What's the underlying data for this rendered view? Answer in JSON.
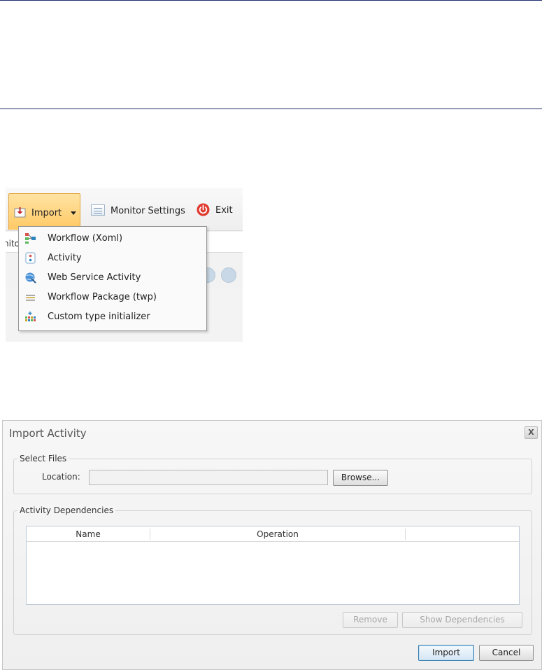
{
  "toolbar": {
    "import_label": "Import",
    "monitor_settings_label": "Monitor Settings",
    "exit_label": "Exit",
    "underlying_tab_text": "nito"
  },
  "import_menu": {
    "items": [
      {
        "label": "Workflow (Xoml)",
        "icon": "workflow-icon"
      },
      {
        "label": "Activity",
        "icon": "activity-icon"
      },
      {
        "label": "Web Service Activity",
        "icon": "web-service-icon"
      },
      {
        "label": "Workflow Package (twp)",
        "icon": "workflow-package-icon"
      },
      {
        "label": "Custom type initializer",
        "icon": "custom-type-icon"
      }
    ]
  },
  "dialog": {
    "title": "Import Activity",
    "close_label": "X",
    "select_files": {
      "legend": "Select Files",
      "location_label": "Location:",
      "location_value": "",
      "browse_label": "Browse..."
    },
    "dependencies": {
      "legend": "Activity Dependencies",
      "columns": [
        "Name",
        "Operation",
        ""
      ],
      "rows": [],
      "remove_label": "Remove",
      "show_dependencies_label": "Show Dependencies"
    },
    "import_label": "Import",
    "cancel_label": "Cancel"
  },
  "colors": {
    "import_highlight": "#ffc964",
    "exit_red": "#e03a2f",
    "rule_navy": "#1f2f6e"
  }
}
